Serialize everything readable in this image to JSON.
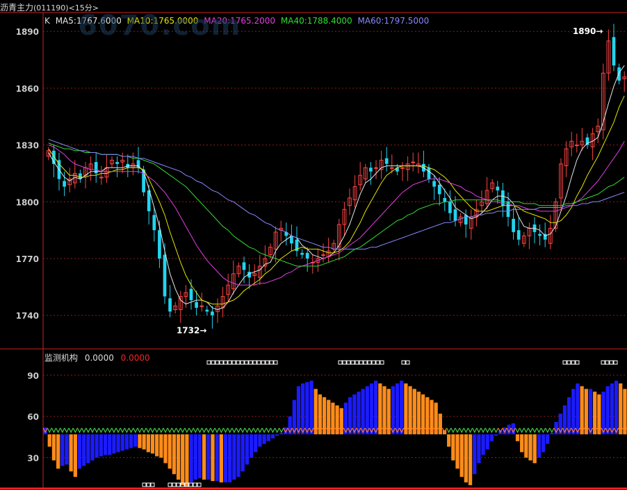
{
  "window": {
    "title": "沥青主力",
    "code": "(011190)",
    "period": "<15分>"
  },
  "watermark": "6070.com",
  "colors": {
    "up": "#ff4444",
    "down": "#22d4f0",
    "ma5": "#e8e8e8",
    "ma10": "#e6e600",
    "ma20": "#e040e0",
    "ma40": "#33dd33",
    "ma60": "#8888ff",
    "grid": "#8a1e1e",
    "axis": "#cc2222",
    "label": "#cccccc",
    "blue_bar": "#1b1bff",
    "orange_bar": "#ff8c1a",
    "green_marker": "#44cc44",
    "orange_marker": "#ff7a1a",
    "zero_red": "#ff2020"
  },
  "legend": {
    "k_label": "K",
    "ma5": "MA5:1767.6000",
    "ma10": "MA10:1765.0000",
    "ma20": "MA20:1765.2000",
    "ma40": "MA40:1788.4000",
    "ma60": "MA60:1797.5000"
  },
  "indicator": {
    "name": "监测机构",
    "value1": "0.0000",
    "value2": "0.0000"
  },
  "chart_data": [
    {
      "type": "candlestick",
      "ylim": [
        1723,
        1900
      ],
      "yticks": [
        1740,
        1770,
        1800,
        1830,
        1860,
        1890
      ],
      "annotations": [
        {
          "label": "1890",
          "value": 1890
        },
        {
          "label": "1732",
          "value": 1732
        }
      ],
      "close_series": [
        1827,
        1820,
        1812,
        1808,
        1812,
        1815,
        1812,
        1818,
        1820,
        1815,
        1813,
        1818,
        1822,
        1820,
        1822,
        1818,
        1820,
        1818,
        1805,
        1795,
        1785,
        1770,
        1750,
        1742,
        1745,
        1750,
        1752,
        1748,
        1744,
        1745,
        1742,
        1740,
        1745,
        1750,
        1756,
        1762,
        1766,
        1764,
        1760,
        1762,
        1766,
        1770,
        1776,
        1784,
        1786,
        1782,
        1778,
        1774,
        1772,
        1770,
        1768,
        1770,
        1772,
        1774,
        1778,
        1788,
        1796,
        1802,
        1808,
        1814,
        1818,
        1816,
        1818,
        1822,
        1820,
        1818,
        1816,
        1818,
        1820,
        1821,
        1820,
        1816,
        1812,
        1808,
        1804,
        1800,
        1794,
        1790,
        1792,
        1788,
        1792,
        1796,
        1800,
        1806,
        1810,
        1806,
        1798,
        1792,
        1784,
        1780,
        1782,
        1786,
        1784,
        1782,
        1780,
        1786,
        1800,
        1820,
        1828,
        1832,
        1830,
        1832,
        1830,
        1836,
        1840,
        1868,
        1885,
        1872,
        1864,
        1866
      ],
      "ma": {
        "MA5": [
          1826,
          1821,
          1817,
          1813,
          1811,
          1813,
          1812,
          1814,
          1816,
          1816,
          1816,
          1818,
          1818,
          1818,
          1818,
          1819,
          1819,
          1819,
          1816,
          1807,
          1797,
          1787,
          1774,
          1762,
          1754,
          1748,
          1746,
          1747,
          1748,
          1748,
          1747,
          1744,
          1743,
          1744,
          1747,
          1752,
          1756,
          1760,
          1762,
          1763,
          1764,
          1767,
          1768,
          1774,
          1778,
          1780,
          1782,
          1781,
          1777,
          1775,
          1772,
          1771,
          1770,
          1771,
          1773,
          1777,
          1782,
          1788,
          1796,
          1804,
          1810,
          1812,
          1815,
          1818,
          1819,
          1819,
          1819,
          1819,
          1819,
          1819,
          1819,
          1818,
          1816,
          1814,
          1810,
          1806,
          1802,
          1797,
          1795,
          1793,
          1791,
          1792,
          1794,
          1797,
          1801,
          1803,
          1803,
          1802,
          1799,
          1792,
          1787,
          1786,
          1786,
          1785,
          1782,
          1783,
          1787,
          1795,
          1803,
          1813,
          1822,
          1828,
          1831,
          1832,
          1834,
          1842,
          1852,
          1861,
          1868,
          1872
        ],
        "MA10": [
          1828,
          1824,
          1820,
          1817,
          1814,
          1814,
          1813,
          1813,
          1814,
          1814,
          1815,
          1815,
          1816,
          1817,
          1817,
          1818,
          1818,
          1818,
          1817,
          1812,
          1806,
          1800,
          1793,
          1784,
          1776,
          1768,
          1761,
          1756,
          1752,
          1748,
          1747,
          1746,
          1746,
          1746,
          1747,
          1748,
          1750,
          1753,
          1755,
          1757,
          1759,
          1762,
          1764,
          1767,
          1770,
          1772,
          1774,
          1775,
          1776,
          1775,
          1775,
          1775,
          1774,
          1773,
          1773,
          1774,
          1776,
          1779,
          1784,
          1789,
          1795,
          1800,
          1805,
          1810,
          1814,
          1816,
          1818,
          1819,
          1819,
          1819,
          1819,
          1819,
          1818,
          1817,
          1815,
          1813,
          1810,
          1806,
          1803,
          1800,
          1797,
          1795,
          1795,
          1795,
          1796,
          1797,
          1798,
          1798,
          1798,
          1797,
          1795,
          1794,
          1793,
          1792,
          1791,
          1789,
          1789,
          1790,
          1793,
          1797,
          1803,
          1808,
          1814,
          1819,
          1824,
          1830,
          1836,
          1842,
          1850,
          1856
        ],
        "MA20": [
          1830,
          1829,
          1827,
          1825,
          1822,
          1820,
          1819,
          1818,
          1817,
          1817,
          1816,
          1816,
          1816,
          1816,
          1816,
          1816,
          1816,
          1816,
          1815,
          1813,
          1811,
          1808,
          1805,
          1801,
          1797,
          1792,
          1787,
          1782,
          1777,
          1773,
          1769,
          1766,
          1763,
          1760,
          1758,
          1757,
          1756,
          1756,
          1756,
          1756,
          1757,
          1757,
          1758,
          1759,
          1760,
          1762,
          1763,
          1765,
          1766,
          1767,
          1768,
          1769,
          1770,
          1771,
          1772,
          1773,
          1775,
          1777,
          1779,
          1781,
          1784,
          1787,
          1790,
          1793,
          1796,
          1799,
          1802,
          1805,
          1807,
          1809,
          1810,
          1811,
          1812,
          1812,
          1812,
          1811,
          1810,
          1809,
          1808,
          1806,
          1805,
          1803,
          1802,
          1801,
          1800,
          1800,
          1799,
          1799,
          1798,
          1798,
          1797,
          1796,
          1796,
          1795,
          1795,
          1795,
          1795,
          1796,
          1797,
          1798,
          1800,
          1802,
          1805,
          1808,
          1811,
          1815,
          1819,
          1823,
          1827,
          1832
        ],
        "MA40": [
          1831,
          1830,
          1829,
          1828,
          1828,
          1827,
          1827,
          1826,
          1826,
          1826,
          1825,
          1825,
          1825,
          1825,
          1824,
          1824,
          1823,
          1823,
          1822,
          1821,
          1820,
          1818,
          1816,
          1814,
          1812,
          1810,
          1808,
          1805,
          1802,
          1799,
          1796,
          1793,
          1790,
          1787,
          1785,
          1782,
          1780,
          1778,
          1776,
          1775,
          1773,
          1772,
          1771,
          1770,
          1769,
          1768,
          1767,
          1766,
          1766,
          1766,
          1766,
          1766,
          1767,
          1768,
          1769,
          1770,
          1771,
          1773,
          1775,
          1776,
          1778,
          1780,
          1782,
          1784,
          1786,
          1788,
          1790,
          1791,
          1793,
          1794,
          1796,
          1797,
          1798,
          1799,
          1799,
          1800,
          1800,
          1801,
          1801,
          1801,
          1801,
          1801,
          1801,
          1801,
          1801,
          1801,
          1800,
          1800,
          1800,
          1800,
          1799,
          1799,
          1799,
          1798,
          1798,
          1798,
          1798,
          1798,
          1799,
          1799,
          1800,
          1801,
          1802,
          1803,
          1804,
          1806,
          1808,
          1809,
          1811,
          1813
        ],
        "MA60": [
          1833,
          1832,
          1831,
          1830,
          1829,
          1828,
          1827,
          1827,
          1826,
          1826,
          1825,
          1825,
          1825,
          1825,
          1824,
          1824,
          1824,
          1823,
          1823,
          1822,
          1821,
          1820,
          1819,
          1818,
          1817,
          1816,
          1814,
          1813,
          1811,
          1810,
          1808,
          1806,
          1805,
          1803,
          1801,
          1800,
          1798,
          1796,
          1794,
          1793,
          1791,
          1789,
          1788,
          1786,
          1785,
          1784,
          1782,
          1781,
          1780,
          1779,
          1778,
          1777,
          1776,
          1776,
          1775,
          1775,
          1775,
          1775,
          1775,
          1775,
          1775,
          1776,
          1776,
          1777,
          1778,
          1779,
          1780,
          1781,
          1782,
          1783,
          1784,
          1785,
          1786,
          1787,
          1788,
          1789,
          1789,
          1790,
          1791,
          1792,
          1792,
          1793,
          1793,
          1794,
          1794,
          1795,
          1795,
          1795,
          1796,
          1796,
          1796,
          1796,
          1796,
          1797,
          1797,
          1797,
          1797,
          1797,
          1798,
          1798,
          1798,
          1799,
          1799,
          1800,
          1800,
          1801,
          1802,
          1803,
          1804,
          1805
        ]
      }
    },
    {
      "type": "bar",
      "ylim": [
        8,
        100
      ],
      "yticks": [
        30,
        60,
        90
      ],
      "baseline": 47,
      "signal_line": 50,
      "values": [
        52,
        38,
        28,
        22,
        24,
        25,
        20,
        16,
        22,
        24,
        26,
        28,
        30,
        31,
        32,
        32,
        33,
        34,
        35,
        36,
        37,
        38,
        37,
        36,
        34,
        33,
        31,
        30,
        26,
        22,
        18,
        14,
        10,
        9,
        12,
        14,
        15,
        14,
        14,
        13,
        13,
        12,
        12,
        12,
        14,
        16,
        20,
        25,
        30,
        34,
        38,
        40,
        42,
        44,
        46,
        48,
        52,
        60,
        72,
        82,
        84,
        85,
        86,
        80,
        76,
        74,
        72,
        70,
        68,
        66,
        70,
        74,
        76,
        78,
        80,
        82,
        84,
        86,
        84,
        82,
        80,
        82,
        84,
        86,
        84,
        82,
        80,
        78,
        76,
        74,
        72,
        70,
        62,
        50,
        38,
        28,
        22,
        16,
        12,
        10,
        18,
        26,
        32,
        36,
        42,
        46,
        50,
        52,
        54,
        55,
        42,
        34,
        30,
        28,
        26,
        30,
        34,
        40,
        48,
        56,
        62,
        68,
        74,
        80,
        84,
        82,
        80,
        80,
        78,
        76,
        78,
        82,
        84,
        86,
        84,
        80
      ],
      "colors_by_trend": true,
      "top_markers": [
        [
          298,
          398
        ],
        [
          487,
          548
        ],
        [
          578,
          584
        ],
        [
          810,
          830
        ],
        [
          865,
          884
        ]
      ],
      "bottom_markers": [
        [
          205,
          217
        ],
        [
          242,
          284
        ]
      ]
    }
  ]
}
